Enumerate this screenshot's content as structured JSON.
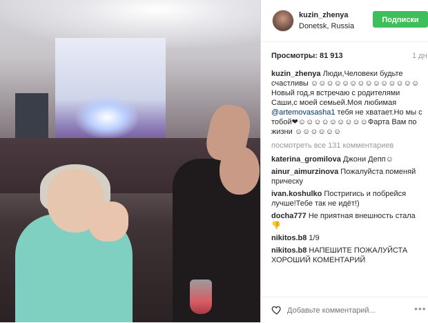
{
  "header": {
    "username": "kuzin_zhenya",
    "location": "Donetsk, Russia",
    "follow_label": "Подписки"
  },
  "stats": {
    "views_label": "Просмотры:",
    "views_count": "81 913",
    "time_ago": "1 дн"
  },
  "caption": {
    "username": "kuzin_zhenya",
    "text_part1": "Люди,Человеки будьте счастливы ☺☺☺☺☺☺☺☺☺☺☺☺☺☺Новый год,я встречаю с родителями Саши,с моей семьей.Моя любимая ",
    "mention": "@artemovasasha1",
    "text_part2": " тебя не хватает.Но мы с тобой❤☺☺☺☺☺☺☺☺☺Фарта Вам по жизни ☺☺☺☺☺☺"
  },
  "view_all_label": "посмотреть все 131 комментариев",
  "comments": [
    {
      "user": "katerina_gromilova",
      "text": "Джони Депп☺"
    },
    {
      "user": "ainur_aimurzinova",
      "text": "Пожалуйста поменяй прическу"
    },
    {
      "user": "ivan.koshulko",
      "text": "Постригись и побрейся лучше!Тебе так не идёт!)"
    },
    {
      "user": "docha777",
      "text": "Не приятная внешность стала👎"
    },
    {
      "user": "nikitos.b8",
      "text": "1/9"
    },
    {
      "user": "nikitos.b8",
      "text": "НАПЕШИТЕ ПОЖАЛУЙСТА ХОРОШИЙ КОМЕНТАРИЙ"
    }
  ],
  "add_comment": {
    "placeholder": "Добавьте комментарий...",
    "more_label": "•••"
  },
  "colors": {
    "follow_button": "#3fbf5c",
    "mention": "#003569",
    "muted": "#999999"
  },
  "icons": {
    "like": "heart-icon",
    "options": "more-options-icon"
  }
}
